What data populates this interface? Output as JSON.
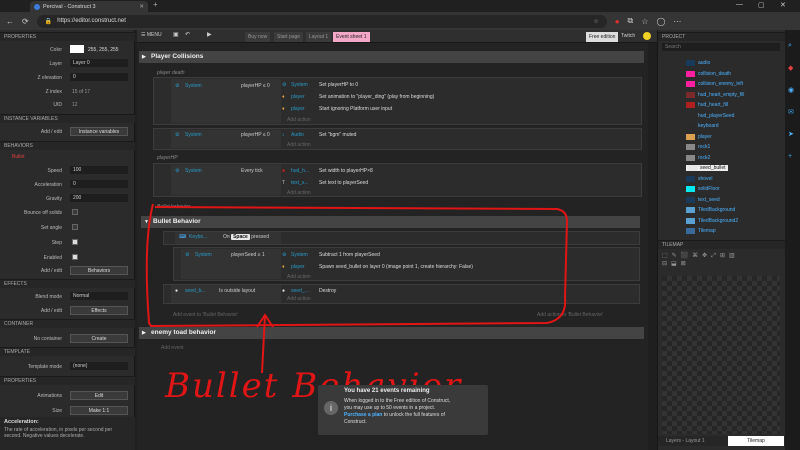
{
  "browser": {
    "tab_title": "Percival - Construct 3",
    "url": "https://editor.construct.net"
  },
  "menubar": {
    "menu_label": "MENU",
    "tabs": [
      "Buy now",
      "Start page",
      "Layout 1",
      "Event sheet 1"
    ],
    "free_edition": "Free edition",
    "twitch": "Twitch"
  },
  "properties": {
    "header": "PROPERTIES",
    "color_label": "Color",
    "color_value": "255, 255, 255",
    "layer_label": "Layer",
    "layer_value": "Layer 0",
    "zelev_label": "Z elevation",
    "zelev_value": "0",
    "zindex_label": "Z index",
    "zindex_value": "15 of 17",
    "uid_label": "UID",
    "uid_value": "12",
    "instvar_header": "INSTANCE VARIABLES",
    "addedit_label": "Add / edit",
    "instvar_button": "Instance variables",
    "behaviors_header": "BEHAVIORS",
    "bullet_label": "Bullet",
    "speed_label": "Speed",
    "speed_value": "100",
    "accel_label": "Acceleration",
    "accel_value": "0",
    "gravity_label": "Gravity",
    "gravity_value": "200",
    "bounce_label": "Bounce off solids",
    "setangle_label": "Set angle",
    "step_label": "Step",
    "enabled_label": "Enabled",
    "behaviors_button": "Behaviors",
    "effects_header": "EFFECTS",
    "blend_label": "Blend mode",
    "blend_value": "Normal",
    "effects_button": "Effects",
    "container_header": "CONTAINER",
    "nocontainer_label": "No container",
    "create_button": "Create",
    "template_header": "TEMPLATE",
    "templatemode_label": "Template mode",
    "templatemode_value": "(none)",
    "properties_header2": "PROPERTIES",
    "animations_label": "Animations",
    "edit_button": "Edit",
    "size_label": "Size",
    "make11_button": "Make 1:1",
    "help_title": "Acceleration:",
    "help_text": "The rate of acceleration, in pixels per second per second. Negative values decelerate."
  },
  "sheet": {
    "group1": "Player Collisions",
    "comment_death": "player death",
    "ev1_obj": "System",
    "ev1_cond": "playerHP ≤ 0",
    "ev1_a1_obj": "System",
    "ev1_a1": "Set playerHP to 0",
    "ev1_a2_obj": "player",
    "ev1_a2": "Set animation to \"player_ding\" (play from beginning)",
    "ev1_a3_obj": "player",
    "ev1_a3": "Start ignoring  Platform user input",
    "add_action": "Add action",
    "ev2_obj": "System",
    "ev2_cond": "playerHP ≤ 0",
    "ev2_a1_obj": "Audio",
    "ev2_a1": "Set \"bgm\" muted",
    "comment_hp": "playerHP",
    "ev3_obj": "System",
    "ev3_cond": "Every tick",
    "ev3_a1_obj": "hud_h...",
    "ev3_a1": "Set width to playerHP×8",
    "ev3_a2_obj": "text_s...",
    "ev3_a2": "Set text to playerSeed",
    "comment_bullet": "Bullet behavior",
    "group2": "Bullet Behavior",
    "ev4_obj": "Keybo...",
    "ev4_cond_pre": "On",
    "ev4_key": "Space",
    "ev4_cond_post": "pressed",
    "ev5_obj": "System",
    "ev5_cond": "playerSeed ≥ 1",
    "ev5_a1_obj": "System",
    "ev5_a1": "Subtract 1 from playerSeed",
    "ev5_a2_obj": "player",
    "ev5_a2": "Spawn  seed_bullet on layer 0 (image point 1, create hierarchy: False)",
    "ev6_obj": "seed_b...",
    "ev6_cond": "Is outside layout",
    "ev6_a1_obj": "seed_...",
    "ev6_a1": "Destroy",
    "add_event_to": "Add event to 'Bullet Behavior'",
    "add_action_to": "Add action to 'Bullet Behavior'",
    "group3": "enemy toad behavior",
    "add_event": "Add event",
    "handwriting": "Bullet Behavior"
  },
  "project": {
    "header": "PROJECT",
    "search_placeholder": "Search",
    "items": [
      "audio",
      "collision_death",
      "collision_enemy_left",
      "hud_heart_empty_fill",
      "hud_heart_fill",
      "hud_playerSeed",
      "keyboard",
      "player",
      "rock1",
      "rock2",
      "seed_bullet",
      "shovel",
      "solidFloor",
      "text_seed",
      "TiledBackground",
      "TiledBackground2",
      "Tilemap"
    ],
    "item_colors": [
      "#1a3a5a",
      "#ff1fa0",
      "#ff1fa0",
      "#7a2a2a",
      "#b02020",
      "#2a2a2a",
      "#2a2a2a",
      "#d8a050",
      "#888888",
      "#888888",
      "#e8e8e8",
      "#1a3a5a",
      "#00e8f0",
      "#1a3a5a",
      "#5aa0d0",
      "#5aa0d0",
      "#3a6a9a"
    ]
  },
  "tilemap": {
    "header": "TILEMAP",
    "footer_left": "Layers - Layout 1",
    "footer_right": "Tilemap"
  },
  "toast": {
    "title": "You have 21 events remaining",
    "line1": "When logged in to the Free edition of Construct,",
    "line2": "you may use up to 50 events in a project.",
    "link": "Purchase a plan",
    "line3": "to unlock the full features of",
    "line4": "Construct."
  }
}
